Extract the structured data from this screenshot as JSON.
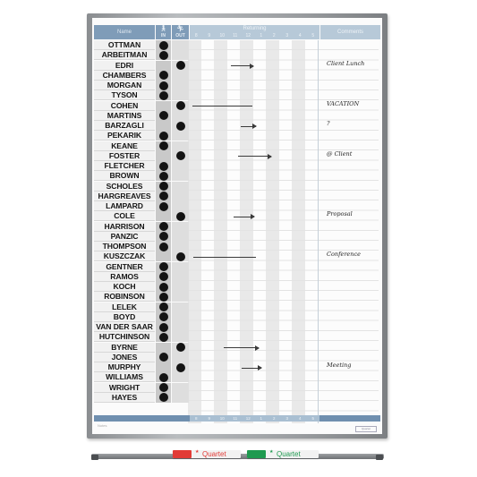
{
  "board": {
    "header": {
      "name": "Name",
      "in_label": "IN",
      "out_label": "OUT",
      "in_icon": "person-in-icon",
      "out_icon": "person-out-icon",
      "returning": "Returning",
      "hours": [
        "8",
        "9",
        "10",
        "11",
        "12",
        "1",
        "2",
        "3",
        "4",
        "5"
      ],
      "comments": "Comments"
    },
    "rows": [
      {
        "name": "OTTMAN",
        "status": "in",
        "comment": ""
      },
      {
        "name": "ARBEITMAN",
        "status": "in",
        "comment": ""
      },
      {
        "name": "EDRI",
        "status": "out",
        "comment": "Client Lunch",
        "returning_from": 11.2,
        "returning_to": 12.9,
        "arrow": true
      },
      {
        "name": "CHAMBERS",
        "status": "in",
        "comment": ""
      },
      {
        "name": "MORGAN",
        "status": "in",
        "comment": ""
      },
      {
        "name": "TYSON",
        "status": "in",
        "comment": ""
      },
      {
        "name": "COHEN",
        "status": "out",
        "comment": "VACATION",
        "returning_from": 8.2,
        "returning_to": 12.8,
        "arrow": false
      },
      {
        "name": "MARTINS",
        "status": "in",
        "comment": ""
      },
      {
        "name": "BARZAGLI",
        "status": "out",
        "comment": "?",
        "returning_from": 11.9,
        "returning_to": 13.1,
        "arrow": true
      },
      {
        "name": "PEKARIK",
        "status": "in",
        "comment": ""
      },
      {
        "name": "KEANE",
        "status": "in",
        "comment": ""
      },
      {
        "name": "FOSTER",
        "status": "out",
        "comment": "@ Client",
        "returning_from": 11.7,
        "returning_to": 14.3,
        "arrow": true
      },
      {
        "name": "FLETCHER",
        "status": "in",
        "comment": ""
      },
      {
        "name": "BROWN",
        "status": "in",
        "comment": ""
      },
      {
        "name": "SCHOLES",
        "status": "in",
        "comment": ""
      },
      {
        "name": "HARGREAVES",
        "status": "in",
        "comment": ""
      },
      {
        "name": "LAMPARD",
        "status": "in",
        "comment": ""
      },
      {
        "name": "COLE",
        "status": "out",
        "comment": "Proposal",
        "returning_from": 11.4,
        "returning_to": 13.0,
        "arrow": true
      },
      {
        "name": "HARRISON",
        "status": "in",
        "comment": ""
      },
      {
        "name": "PANZIC",
        "status": "in",
        "comment": ""
      },
      {
        "name": "THOMPSON",
        "status": "in",
        "comment": ""
      },
      {
        "name": "KUSZCZAK",
        "status": "out",
        "comment": "Conference",
        "returning_from": 8.3,
        "returning_to": 13.1,
        "arrow": false
      },
      {
        "name": "GENTNER",
        "status": "in",
        "comment": ""
      },
      {
        "name": "RAMOS",
        "status": "in",
        "comment": ""
      },
      {
        "name": "KOCH",
        "status": "in",
        "comment": ""
      },
      {
        "name": "ROBINSON",
        "status": "in",
        "comment": ""
      },
      {
        "name": "LELEK",
        "status": "in",
        "comment": ""
      },
      {
        "name": "BOYD",
        "status": "in",
        "comment": ""
      },
      {
        "name": "VAN DER SAAR",
        "status": "in",
        "comment": ""
      },
      {
        "name": "HUTCHINSON",
        "status": "in",
        "comment": ""
      },
      {
        "name": "BYRNE",
        "status": "out",
        "comment": "",
        "returning_from": 10.6,
        "returning_to": 13.3,
        "arrow": true
      },
      {
        "name": "JONES",
        "status": "in",
        "comment": ""
      },
      {
        "name": "MURPHY",
        "status": "out",
        "comment": "Meeting",
        "returning_from": 12.0,
        "returning_to": 13.5,
        "arrow": true
      },
      {
        "name": "WILLIAMS",
        "status": "in",
        "comment": ""
      },
      {
        "name": "WRIGHT",
        "status": "in",
        "comment": ""
      },
      {
        "name": "HAYES",
        "status": "in",
        "comment": ""
      }
    ],
    "notes_label": "Notes",
    "brand_tag": "Quartet"
  },
  "markers": [
    {
      "label": "Quartet",
      "color": "#e23b36"
    },
    {
      "label": "Quartet",
      "color": "#1f9a50"
    }
  ],
  "colors": {
    "header_blue": "#7f9cb8",
    "header_light_blue": "#b7c9d8",
    "dot": "#141414"
  }
}
